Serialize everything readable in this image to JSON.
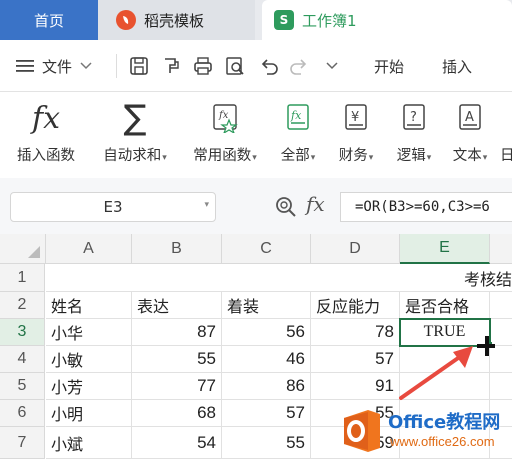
{
  "tabs": {
    "home": "首页",
    "daoke": "稻壳模板",
    "workbook": "工作簿1",
    "workbook_icon_letter": "S"
  },
  "menu": {
    "file": "文件",
    "start": "开始",
    "insert": "插入"
  },
  "ribbon": [
    {
      "label": "插入函数"
    },
    {
      "label": "自动求和"
    },
    {
      "label": "常用函数"
    },
    {
      "label": "全部"
    },
    {
      "label": "财务"
    },
    {
      "label": "逻辑"
    },
    {
      "label": "文本"
    },
    {
      "label": "日"
    }
  ],
  "formula_bar": {
    "cell_ref": "E3",
    "fx": "fx",
    "formula": "=OR(B3>=60,C3>=6"
  },
  "grid": {
    "columns": [
      "A",
      "B",
      "C",
      "D",
      "E"
    ],
    "rows": [
      "1",
      "2",
      "3",
      "4",
      "5",
      "6",
      "7"
    ],
    "title": "考核结",
    "headers": [
      "姓名",
      "表达",
      "着装",
      "反应能力",
      "是否合格"
    ],
    "data": [
      [
        "小华",
        "87",
        "56",
        "78",
        "TRUE"
      ],
      [
        "小敏",
        "55",
        "46",
        "57",
        ""
      ],
      [
        "小芳",
        "77",
        "86",
        "91",
        ""
      ],
      [
        "小明",
        "68",
        "57",
        "55",
        ""
      ],
      [
        "小斌",
        "54",
        "55",
        "59",
        ""
      ]
    ],
    "selected_cell": "E3"
  },
  "watermark": {
    "brand": "Office教程网",
    "url": "www.office26.com"
  },
  "colors": {
    "home_tab": "#3a73c7",
    "daoke_icon": "#e8522f",
    "workbook_icon": "#2e9b5d",
    "selection": "#217346",
    "arrow": "#e84a3f",
    "watermark_orange": "#f0751e"
  }
}
